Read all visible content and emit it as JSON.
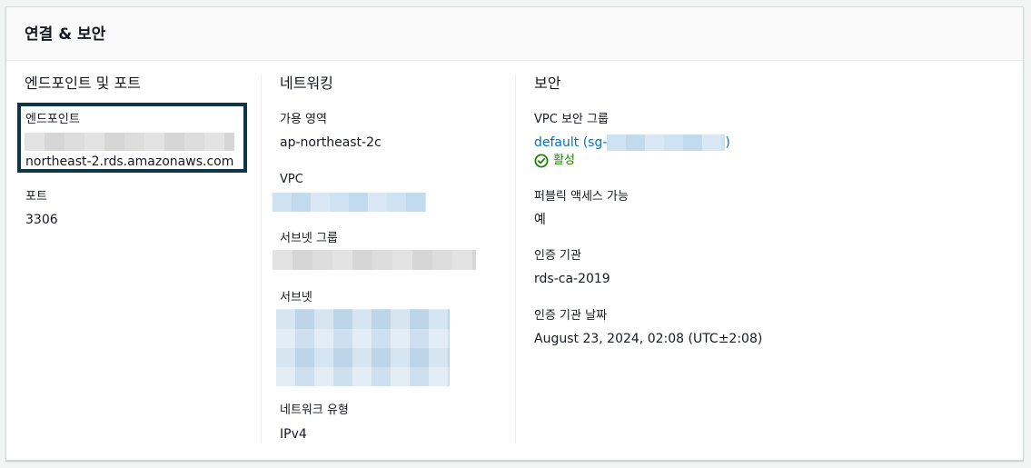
{
  "panel": {
    "title": "연결 & 보안"
  },
  "endpoint_section": {
    "title": "엔드포인트 및 포트",
    "endpoint_label": "엔드포인트",
    "endpoint_value_suffix": "northeast-2.rds.amazonaws.com",
    "port_label": "포트",
    "port_value": "3306"
  },
  "networking_section": {
    "title": "네트워킹",
    "az_label": "가용 영역",
    "az_value": "ap-northeast-2c",
    "vpc_label": "VPC",
    "subnet_group_label": "서브넷 그룹",
    "subnet_label": "서브넷",
    "network_type_label": "네트워크 유형",
    "network_type_value": "IPv4"
  },
  "security_section": {
    "title": "보안",
    "sg_label": "VPC 보안 그룹",
    "sg_link_prefix": "default (sg-",
    "sg_link_suffix": ")",
    "sg_status": "활성",
    "public_access_label": "퍼블릭 액세스 가능",
    "public_access_value": "예",
    "ca_label": "인증 기관",
    "ca_value": "rds-ca-2019",
    "ca_date_label": "인증 기관 날짜",
    "ca_date_value": "August 23, 2024, 02:08 (UTC±2:08)"
  },
  "colors": {
    "link": "#0073bb",
    "status_active": "#1d8102",
    "highlight_border": "#0d3746"
  },
  "icons": {
    "status": "check-circle-icon"
  }
}
